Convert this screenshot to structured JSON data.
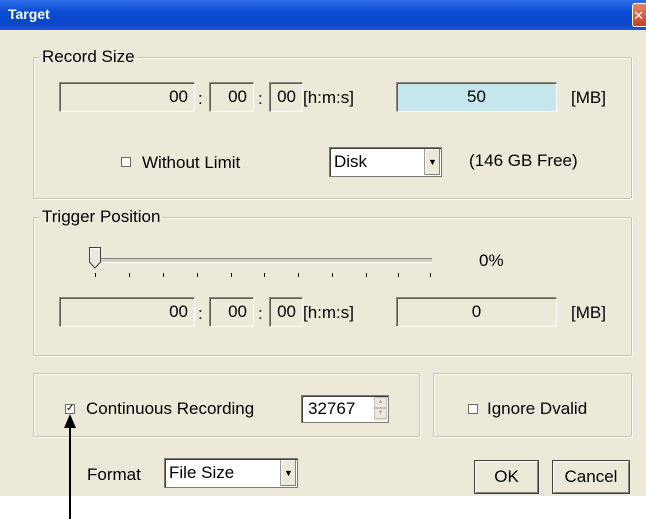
{
  "window": {
    "title": "Target",
    "close_glyph": "✕"
  },
  "record_size": {
    "legend": "Record Size",
    "hours": "00",
    "minutes": "00",
    "seconds": "00",
    "sep": ":",
    "time_unit": "[h:m:s]",
    "size_value": "50",
    "size_unit": "[MB]",
    "without_limit_label": "Without Limit",
    "without_limit_checked": false,
    "destination_selected": "Disk",
    "free_space": "(146 GB Free)"
  },
  "trigger_position": {
    "legend": "Trigger Position",
    "slider_percent_label": "0%",
    "slider_level": 0,
    "hours": "00",
    "minutes": "00",
    "seconds": "00",
    "sep": ":",
    "time_unit": "[h:m:s]",
    "size_value": "0",
    "size_unit": "[MB]"
  },
  "continuous": {
    "label": "Continuous Recording",
    "checked": true,
    "check_glyph": "✓",
    "count_value": "32767"
  },
  "ignore_dvalid": {
    "label": "Ignore Dvalid",
    "checked": false
  },
  "format": {
    "label": "Format",
    "selected": "File Size"
  },
  "buttons": {
    "ok": "OK",
    "cancel": "Cancel"
  },
  "icons": {
    "dropdown_arrow": "▼",
    "spin_up": "▲",
    "spin_down": "▼"
  }
}
